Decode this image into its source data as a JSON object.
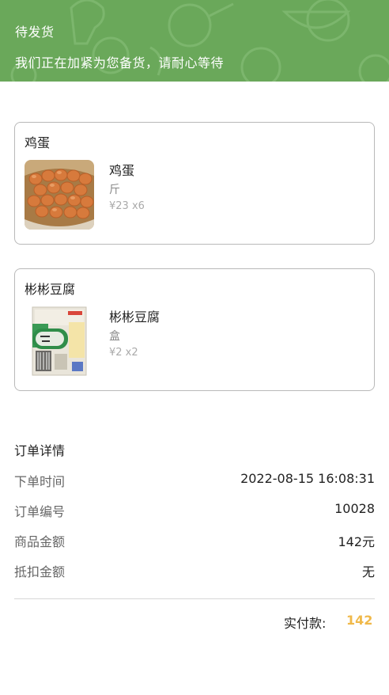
{
  "header": {
    "title": "待发货",
    "subtitle": "我们正在加紧为您备货，请耐心等待",
    "bg_color": "#6aa85a"
  },
  "orders": [
    {
      "store": "鸡蛋",
      "item_name": "鸡蛋",
      "unit": "斤",
      "price_qty": "¥23 x6",
      "thumb_icon": "eggs-basket-image"
    },
    {
      "store": "彬彬豆腐",
      "item_name": "彬彬豆腐",
      "unit": "盒",
      "price_qty": "¥2 x2",
      "thumb_icon": "tofu-package-image"
    }
  ],
  "details": {
    "title": "订单详情",
    "rows": [
      {
        "label": "下单时间",
        "value": "2022-08-15 16:08:31"
      },
      {
        "label": "订单编号",
        "value": "10028"
      },
      {
        "label": "商品金额",
        "value": "142元"
      },
      {
        "label": "抵扣金额",
        "value": "无"
      }
    ]
  },
  "total": {
    "label": "实付款:",
    "value": "142",
    "color": "#f0b94a"
  }
}
